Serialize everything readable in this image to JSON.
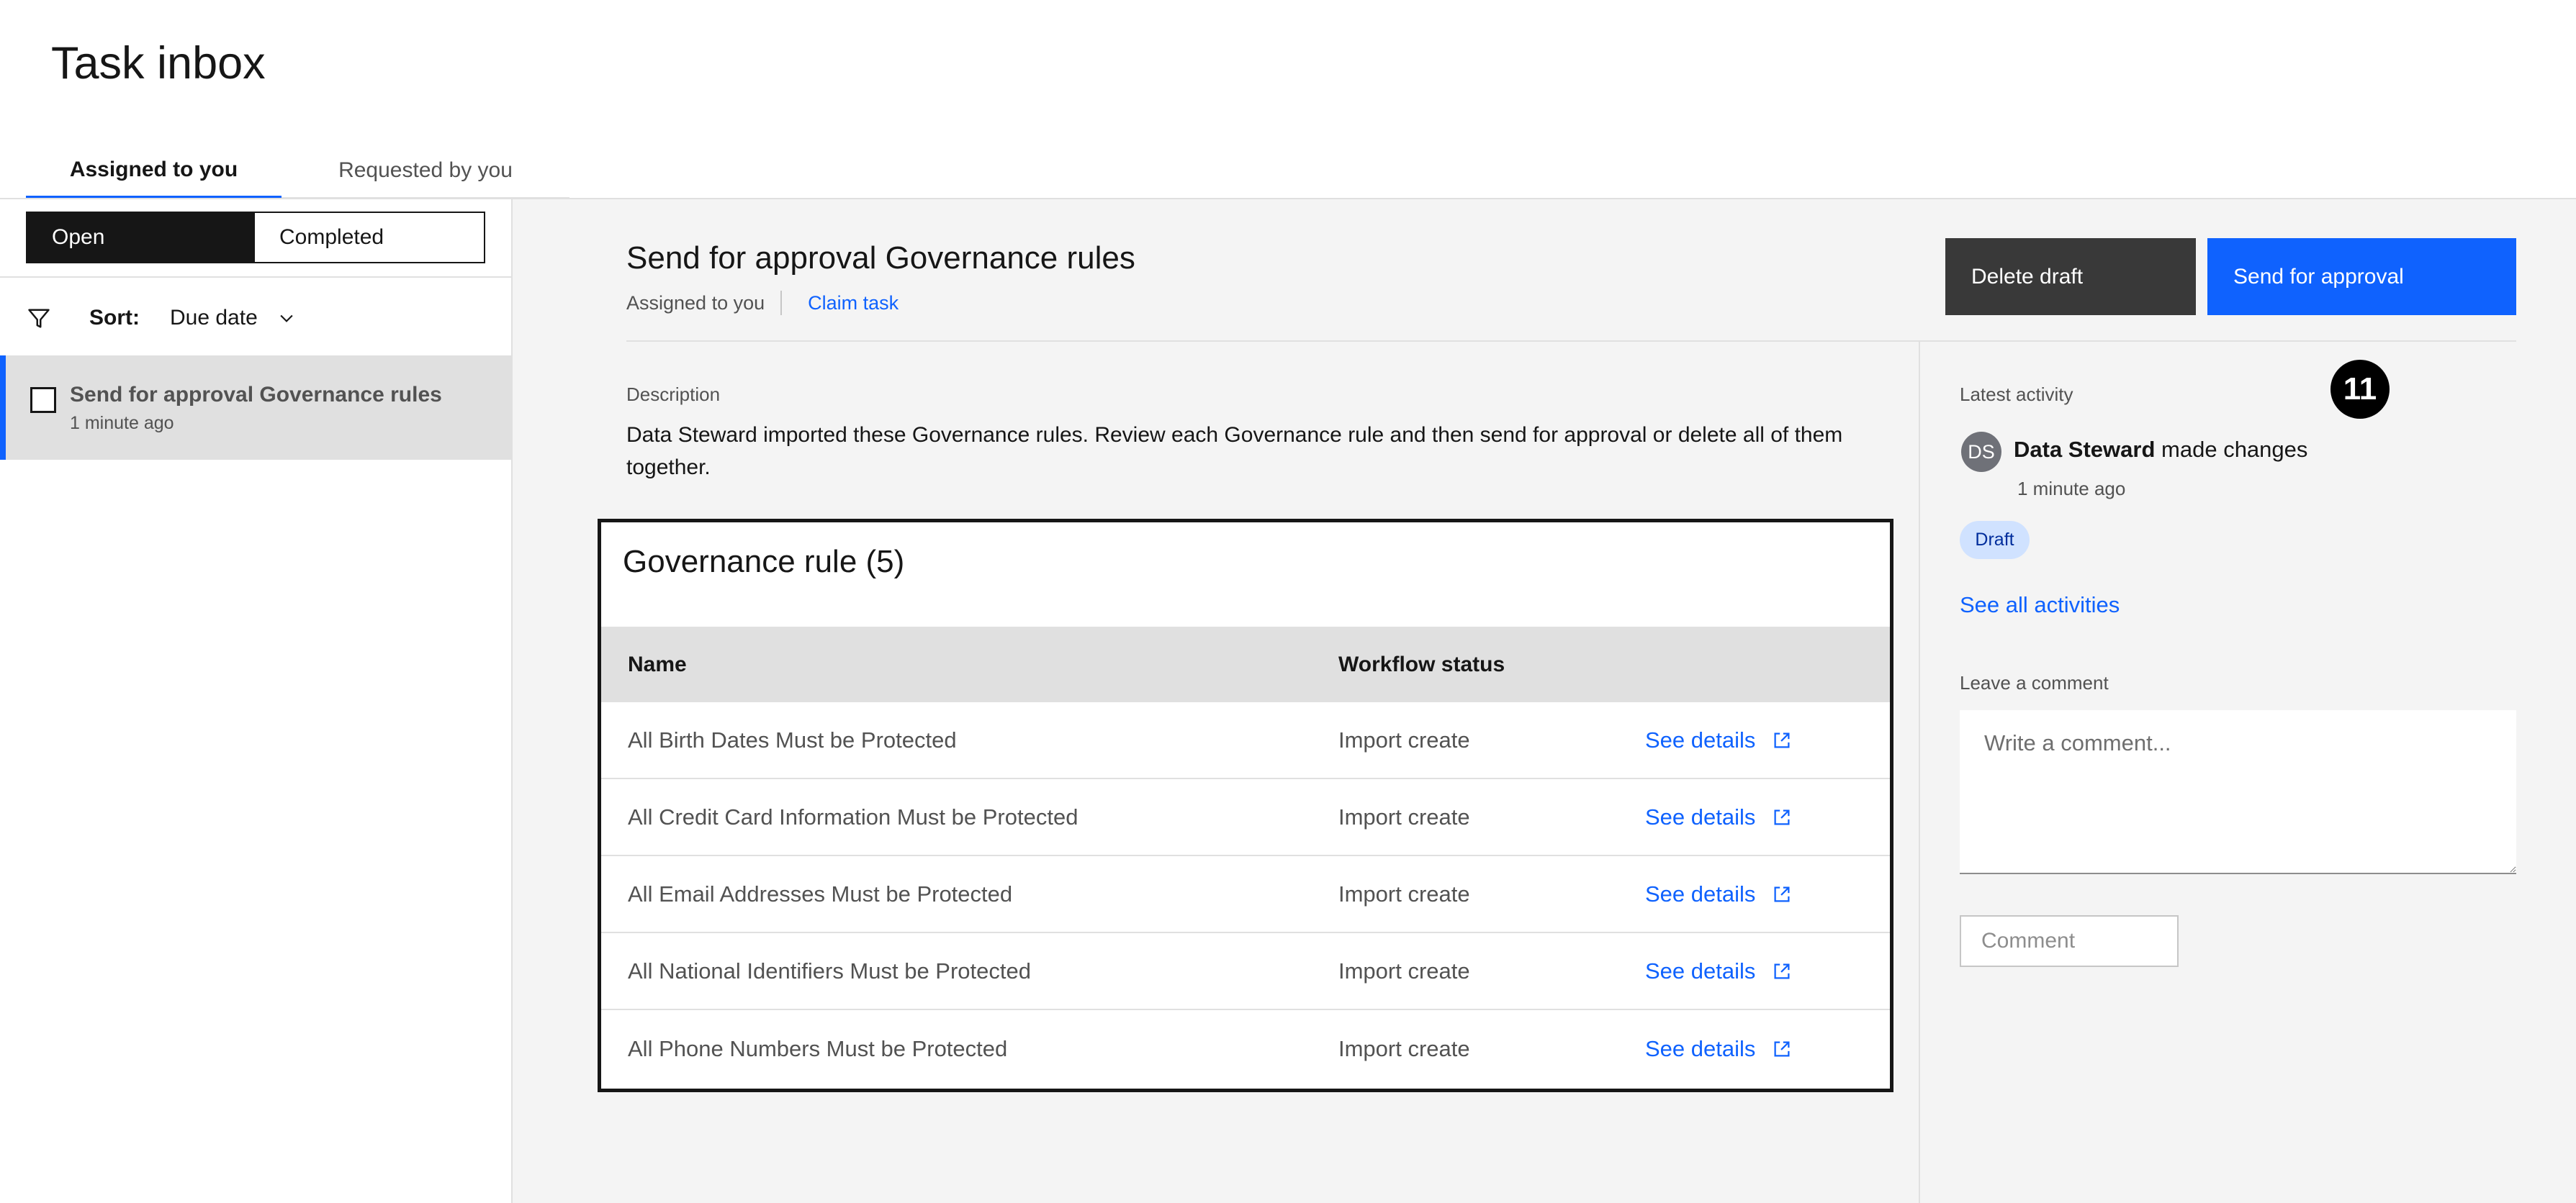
{
  "header": {
    "title": "Task inbox",
    "tabs": [
      {
        "label": "Assigned to you",
        "active": true
      },
      {
        "label": "Requested by you",
        "active": false
      }
    ]
  },
  "left_panel": {
    "segment": {
      "open_label": "Open",
      "completed_label": "Completed",
      "selected": "Open"
    },
    "sort": {
      "label": "Sort:",
      "value": "Due date"
    },
    "tasks": [
      {
        "title": "Send for approval Governance rules",
        "time": "1 minute ago",
        "selected": true
      }
    ]
  },
  "main": {
    "title": "Send for approval Governance rules",
    "assigned_text": "Assigned to you",
    "claim_label": "Claim task",
    "delete_label": "Delete draft",
    "send_label": "Send for approval",
    "description_label": "Description",
    "description": "Data Steward imported these Governance rules. Review each Governance rule and then send for approval or delete all of them together.",
    "table": {
      "title": "Governance rule (5)",
      "headers": {
        "name": "Name",
        "status": "Workflow status"
      },
      "rows": [
        {
          "name": "All Birth Dates Must be Protected",
          "status": "Import create",
          "link": "See details"
        },
        {
          "name": "All Credit Card Information Must be Protected",
          "status": "Import create",
          "link": "See details"
        },
        {
          "name": "All Email Addresses Must be Protected",
          "status": "Import create",
          "link": "See details"
        },
        {
          "name": "All National Identifiers Must be Protected",
          "status": "Import create",
          "link": "See details"
        },
        {
          "name": "All Phone Numbers Must be Protected",
          "status": "Import create",
          "link": "See details"
        }
      ]
    }
  },
  "activity": {
    "label": "Latest activity",
    "badge": "11",
    "avatar_initials": "DS",
    "user": "Data Steward",
    "action": "made changes",
    "time": "1 minute ago",
    "tag": "Draft",
    "see_all": "See all activities",
    "comment_label": "Leave a comment",
    "comment_placeholder": "Write a comment...",
    "comment_value": "",
    "comment_button": "Comment"
  },
  "colors": {
    "accent": "#0f62fe",
    "dark_button": "#393939",
    "tag_bg": "#d0e2ff",
    "main_bg": "#f4f4f4"
  }
}
